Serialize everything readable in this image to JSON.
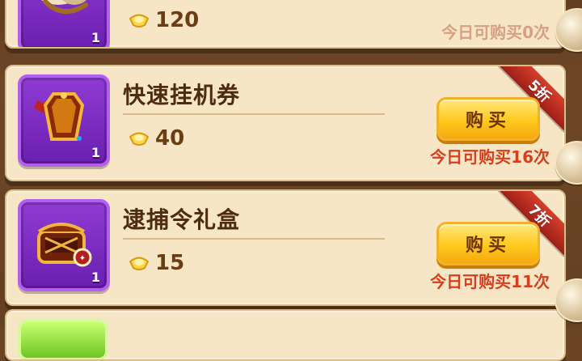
{
  "top_item": {
    "qty": "1",
    "price": "120",
    "limit_text": "今日可购买0次"
  },
  "items": [
    {
      "name": "快速挂机券",
      "qty": "1",
      "price": "40",
      "buy_label": "购买",
      "limit_text": "今日可购买16次",
      "discount": "5折"
    },
    {
      "name": "逮捕令礼盒",
      "qty": "1",
      "price": "15",
      "buy_label": "购买",
      "limit_text": "今日可购买11次",
      "discount": "7折"
    }
  ]
}
